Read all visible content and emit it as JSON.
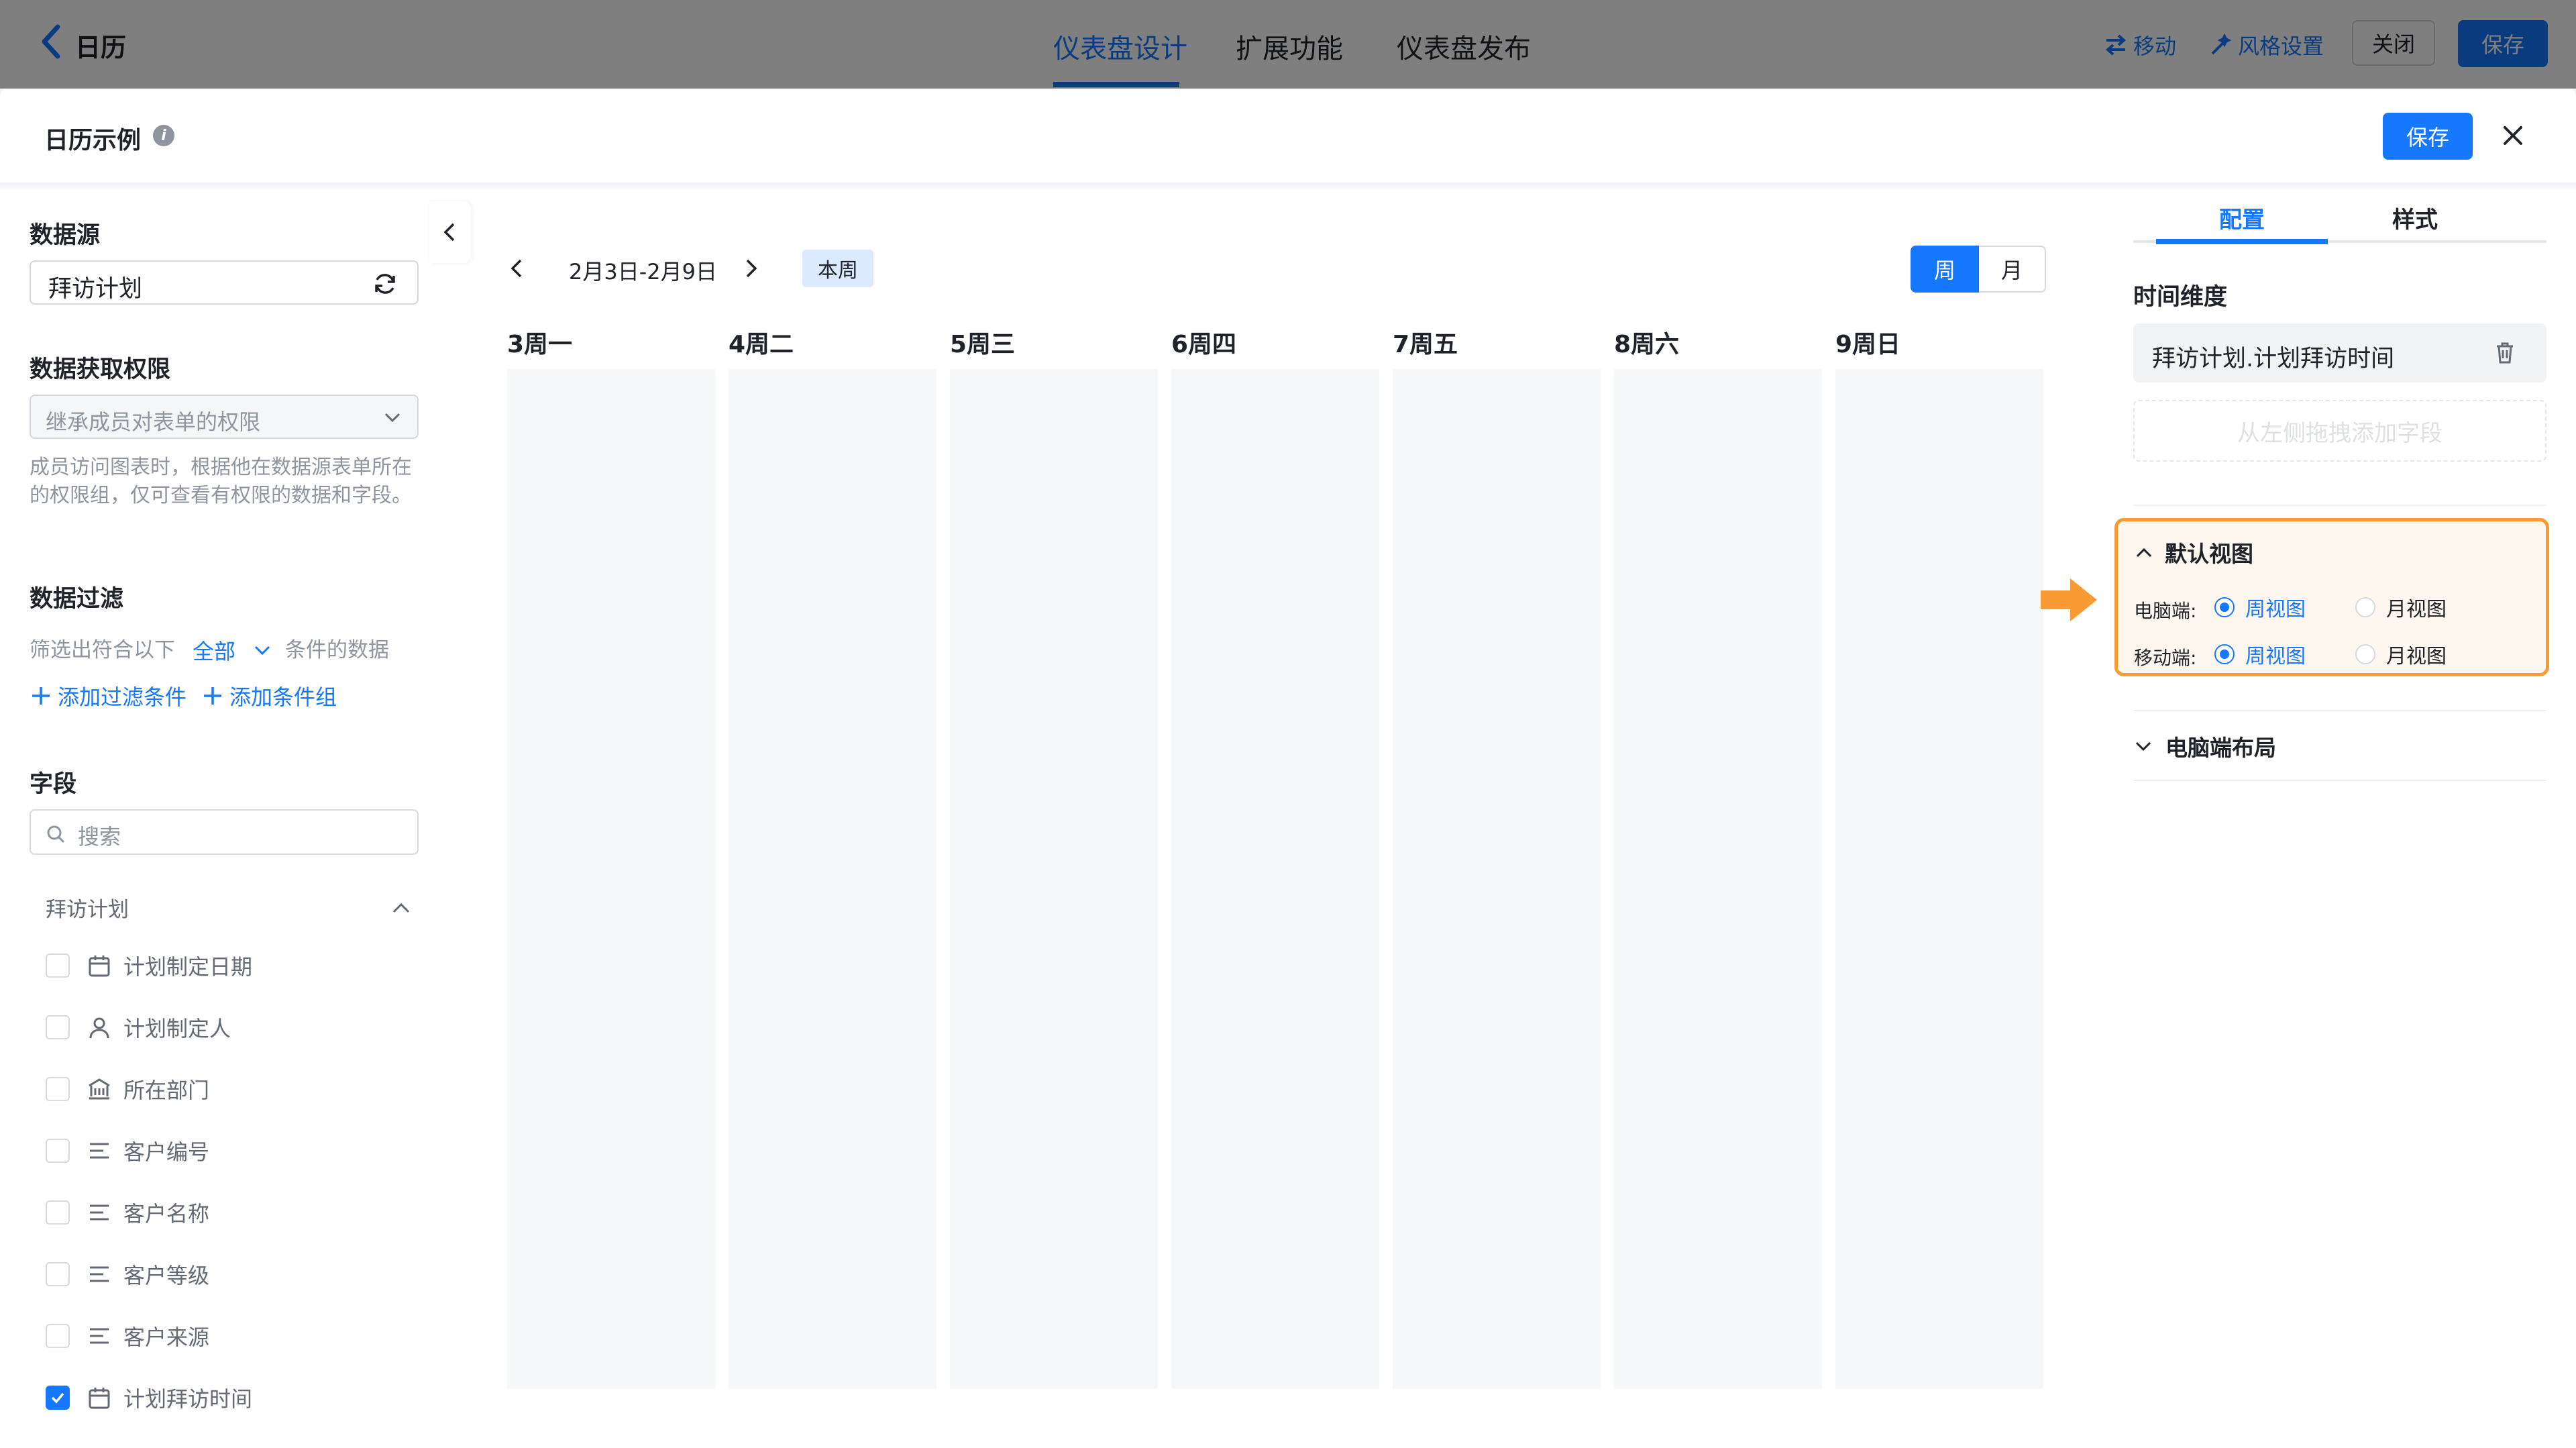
{
  "topbar": {
    "title": "日历",
    "tabs": [
      "仪表盘设计",
      "扩展功能",
      "仪表盘发布"
    ],
    "move_label": "移动",
    "style_label": "风格设置",
    "close_label": "关闭",
    "save_label": "保存"
  },
  "modal": {
    "title": "日历示例",
    "save_label": "保存"
  },
  "left": {
    "datasource_title": "数据源",
    "datasource_value": "拜访计划",
    "permission_title": "数据获取权限",
    "permission_value": "继承成员对表单的权限",
    "permission_desc": "成员访问图表时，根据他在数据源表单所在的权限组，仅可查看有权限的数据和字段。",
    "filter_title": "数据过滤",
    "filter_prefix": "筛选出符合以下",
    "filter_mode": "全部",
    "filter_suffix": "条件的数据",
    "add_filter": "添加过滤条件",
    "add_group": "添加条件组",
    "fields_title": "字段",
    "search_placeholder": "搜索",
    "group_name": "拜访计划",
    "fields": [
      {
        "label": "计划制定日期",
        "icon": "calendar-icon",
        "checked": false
      },
      {
        "label": "计划制定人",
        "icon": "user-icon",
        "checked": false
      },
      {
        "label": "所在部门",
        "icon": "department-icon",
        "checked": false
      },
      {
        "label": "客户编号",
        "icon": "text-icon",
        "checked": false
      },
      {
        "label": "客户名称",
        "icon": "text-icon",
        "checked": false
      },
      {
        "label": "客户等级",
        "icon": "text-icon",
        "checked": false
      },
      {
        "label": "客户来源",
        "icon": "text-icon",
        "checked": false
      },
      {
        "label": "计划拜访时间",
        "icon": "calendar-icon",
        "checked": true
      }
    ]
  },
  "calendar": {
    "range": "2月3日-2月9日",
    "this_week": "本周",
    "view_week": "周",
    "view_month": "月",
    "active_view": "周",
    "days": [
      "3周一",
      "4周二",
      "5周三",
      "6周四",
      "7周五",
      "8周六",
      "9周日"
    ]
  },
  "right": {
    "tab_config": "配置",
    "tab_style": "样式",
    "active_tab": "配置",
    "time_dim_title": "时间维度",
    "time_dim_value": "拜访计划.计划拜访时间",
    "drop_hint": "从左侧拖拽添加字段",
    "default_view_title": "默认视图",
    "pc_label": "电脑端:",
    "mobile_label": "移动端:",
    "week_view": "周视图",
    "month_view": "月视图",
    "pc_selected": "周视图",
    "mobile_selected": "周视图",
    "layout_title": "电脑端布局",
    "accent_color": "#1677ff",
    "highlight_color": "#fa9a32"
  }
}
